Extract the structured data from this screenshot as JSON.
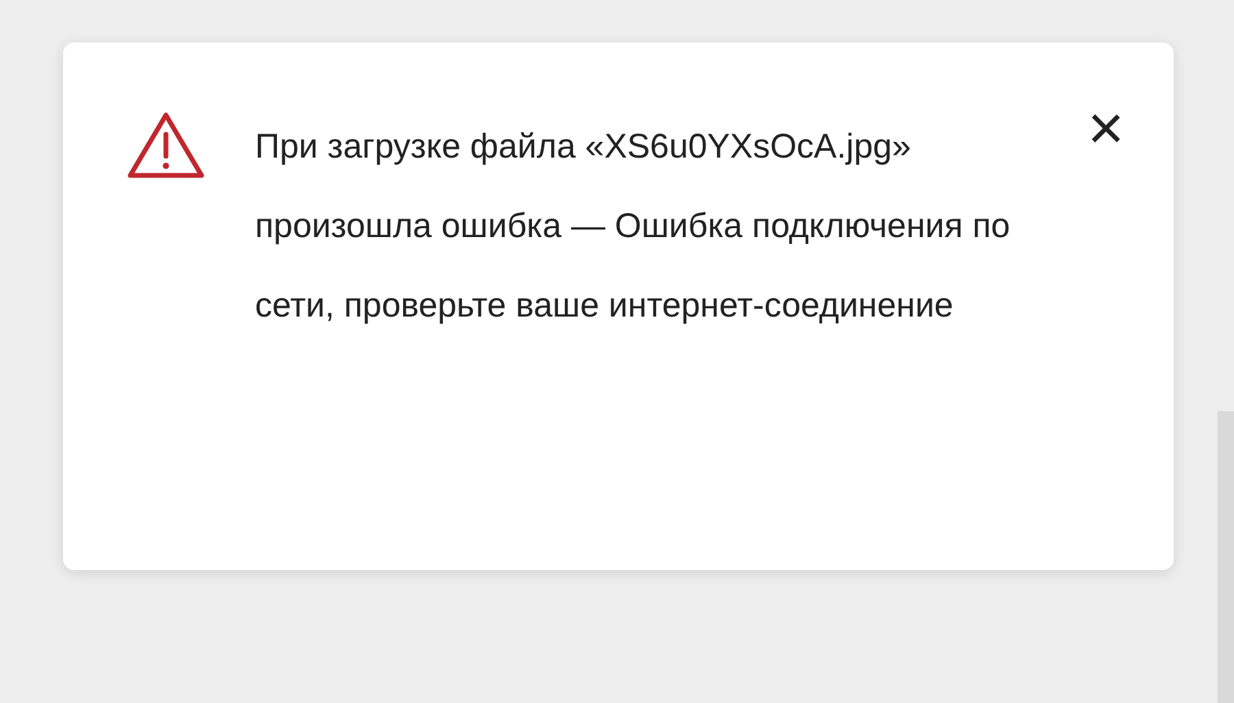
{
  "notification": {
    "kind": "error",
    "message": "При загрузке файла «XS6u0YXsOcA.jpg» произошла ошибка — Ошибка подключения по сети, проверьте ваше интернет-соединение",
    "close_label": "×"
  }
}
